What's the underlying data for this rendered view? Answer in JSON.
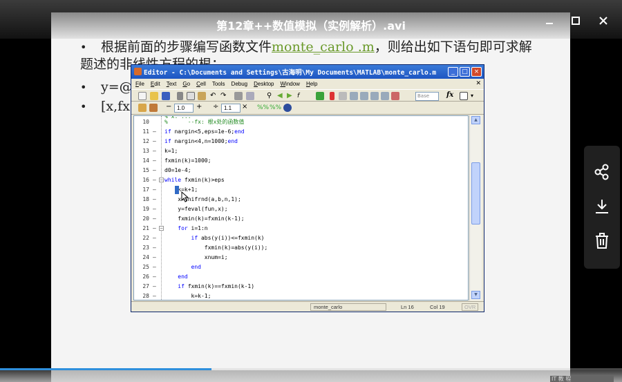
{
  "video": {
    "title": "第12章++数值模拟（实例解析）.avi",
    "progress_fraction": 0.34
  },
  "slide": {
    "bullet1_text_a": "根据前面的步骤编写函数文件",
    "bullet1_link": "monte_carlo .m",
    "bullet1_text_b": "，则给出如下语句即可求解题述的非线性方程的根：",
    "bullet2_text": "y=@(",
    "bullet3_text": "[x,fx]",
    "bullet_char": "•"
  },
  "editor": {
    "title": "Editor - C:\\Documents and Settings\\古海明\\My Documents\\MATLAB\\monte_carlo.m",
    "menu": [
      {
        "u": "F",
        "rest": "ile"
      },
      {
        "u": "E",
        "rest": "dit"
      },
      {
        "u": "T",
        "rest": "ext"
      },
      {
        "u": "G",
        "rest": "o"
      },
      {
        "u": "C",
        "rest": "ell"
      },
      {
        "u": "",
        "rest": "Tools"
      },
      {
        "u": "",
        "rest": "Debug"
      },
      {
        "u": "D",
        "rest": "esktop"
      },
      {
        "u": "W",
        "rest": "indow"
      },
      {
        "u": "H",
        "rest": "elp"
      }
    ],
    "stack_label": "Base",
    "fx_label": "fx",
    "cell_value_1": "1.0",
    "cell_value_2": "1.1",
    "partial_line": "%       x:  ...",
    "code_lines": [
      {
        "n": "10",
        "dash": "",
        "text": "%      --fx: 根x处的函数值"
      },
      {
        "n": "11",
        "dash": "—",
        "text": "if nargin<5,eps=1e-6;end"
      },
      {
        "n": "12",
        "dash": "—",
        "text": "if nargin<4,n=1000;end"
      },
      {
        "n": "13",
        "dash": "—",
        "text": "k=1;"
      },
      {
        "n": "14",
        "dash": "—",
        "text": "fxmin(k)=1000;"
      },
      {
        "n": "15",
        "dash": "—",
        "text": "d0=1e-4;"
      },
      {
        "n": "16",
        "dash": "—",
        "text": "while fxmin(k)>eps"
      },
      {
        "n": "17",
        "dash": "—",
        "text": "    k=k+1;"
      },
      {
        "n": "18",
        "dash": "—",
        "text": "    x=unifrnd(a,b,n,1);"
      },
      {
        "n": "19",
        "dash": "—",
        "text": "    y=feval(fun,x);"
      },
      {
        "n": "20",
        "dash": "—",
        "text": "    fxmin(k)=fxmin(k-1);"
      },
      {
        "n": "21",
        "dash": "—",
        "text": "    for i=1:n"
      },
      {
        "n": "22",
        "dash": "—",
        "text": "        if abs(y(i))<=fxmin(k)"
      },
      {
        "n": "23",
        "dash": "—",
        "text": "            fxmin(k)=abs(y(i));"
      },
      {
        "n": "24",
        "dash": "—",
        "text": "            xnum=i;"
      },
      {
        "n": "25",
        "dash": "—",
        "text": "        end"
      },
      {
        "n": "26",
        "dash": "—",
        "text": "    end"
      },
      {
        "n": "27",
        "dash": "—",
        "text": "    if fxmin(k)==fxmin(k-1)"
      },
      {
        "n": "28",
        "dash": "—",
        "text": "        k=k-1;"
      }
    ],
    "status": {
      "file": "monte_carlo",
      "ln": "Ln  16",
      "col": "Col  19",
      "ovr": "OVR"
    }
  },
  "watermark_text": "IT 教 程",
  "colors": {
    "progress": "#2f8fdc",
    "keyword": "#0000ff",
    "comment": "#228b22"
  }
}
